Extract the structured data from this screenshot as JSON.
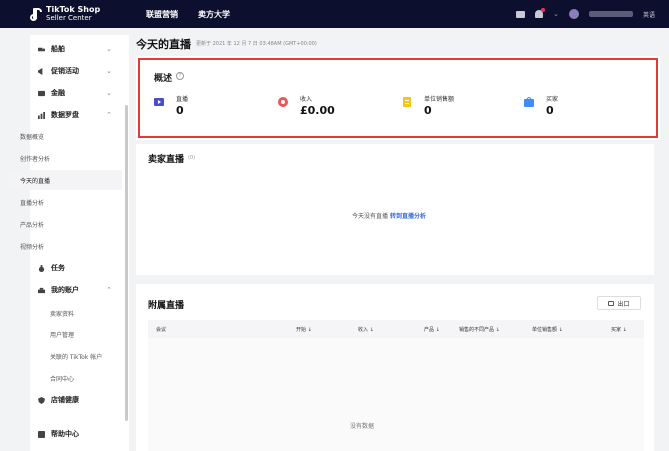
{
  "header": {
    "brand_line1": "TikTok Shop",
    "brand_line2": "Seller Center",
    "nav": [
      "联盟营销",
      "卖方大学"
    ],
    "language": "英语"
  },
  "sidebar": {
    "items": [
      {
        "label": "船舶",
        "expanded": false
      },
      {
        "label": "促销活动",
        "expanded": false
      },
      {
        "label": "金融",
        "expanded": false
      },
      {
        "label": "数据罗盘",
        "expanded": true
      },
      {
        "label": "任务"
      },
      {
        "label": "我的账户",
        "expanded": true
      },
      {
        "label": "店铺健康"
      },
      {
        "label": "帮助中心"
      }
    ],
    "data_compass_children": [
      "数据概览",
      "创作者分析",
      "今天的直播",
      "直播分析",
      "产品分析",
      "视频分析"
    ],
    "account_children": [
      "卖家资料",
      "用户管理",
      "关联的 TikTok 帐户",
      "合同中心"
    ],
    "active_child": "今天的直播"
  },
  "page": {
    "title": "今天的直播",
    "updated": "更新于 2021 年 12 月 7 日 03:48AM (GMT+00:00)"
  },
  "overview": {
    "title": "概述",
    "help_glyph": "?",
    "metrics": [
      {
        "label": "直播",
        "value": "0",
        "icon": "live-icon",
        "color": "#4b4ec8"
      },
      {
        "label": "收入",
        "value": "£0.00",
        "icon": "revenue-icon",
        "color": "#f05454"
      },
      {
        "label": "单位销售额",
        "value": "0",
        "icon": "units-sold-icon",
        "color": "#f5c518"
      },
      {
        "label": "买家",
        "value": "0",
        "icon": "buyers-icon",
        "color": "#3d8ef0"
      }
    ]
  },
  "seller_live": {
    "title": "卖家直播",
    "count": "(0)",
    "empty_text": "今天没有直播",
    "empty_link": "转到直播分析"
  },
  "affiliate_live": {
    "title": "附属直播",
    "export_label": "出口",
    "columns": [
      "会议",
      "开始 ↓",
      "收入 ↓",
      "产品 ↓",
      "销售的不同产品 ↓",
      "单位销售额 ↓",
      "买家 ↓"
    ],
    "no_data": "没有数据"
  }
}
